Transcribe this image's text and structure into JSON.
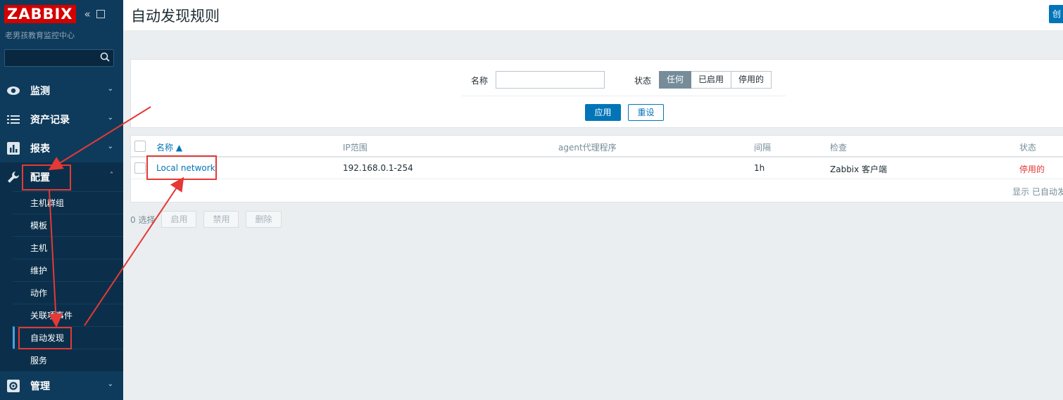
{
  "app": {
    "logo": "ZABBIX",
    "server_name": "老男孩教育监控中心",
    "collapse_icon": "double-chevron-left-icon",
    "kiosk_icon": "fullscreen-icon"
  },
  "search": {
    "placeholder": "",
    "icon": "search-icon"
  },
  "sidebar": {
    "items": [
      {
        "label": "监测",
        "icon": "eye-icon"
      },
      {
        "label": "资产记录",
        "icon": "list-icon"
      },
      {
        "label": "报表",
        "icon": "bar-chart-icon"
      },
      {
        "label": "配置",
        "icon": "wrench-icon"
      },
      {
        "label": "管理",
        "icon": "gear-icon"
      }
    ],
    "submenu": [
      "主机群组",
      "模板",
      "主机",
      "维护",
      "动作",
      "关联项事件",
      "自动发现",
      "服务"
    ]
  },
  "header": {
    "title": "自动发现规则",
    "create_button": "创"
  },
  "filter": {
    "name_label": "名称",
    "name_value": "",
    "status_label": "状态",
    "status_options": [
      "任何",
      "已启用",
      "停用的"
    ],
    "status_selected": "任何",
    "apply_label": "应用",
    "reset_label": "重设"
  },
  "table": {
    "headers": [
      "名称 ▲",
      "IP范围",
      "agent代理程序",
      "间隔",
      "检查",
      "状态"
    ],
    "rows": [
      {
        "name": "Local network",
        "ip_range": "192.168.0.1-254",
        "proxy": "",
        "interval": "1h",
        "checks": "Zabbix 客户端",
        "status": "停用的"
      }
    ],
    "footer": "显示 已自动发"
  },
  "actions": {
    "selected_count": "0 选择",
    "enable": "启用",
    "disable": "禁用",
    "delete": "删除"
  },
  "colors": {
    "brand_red": "#d40000",
    "sidebar_bg": "#0e3b5c",
    "accent_blue": "#0275b8",
    "annotation_red": "#e53935"
  }
}
